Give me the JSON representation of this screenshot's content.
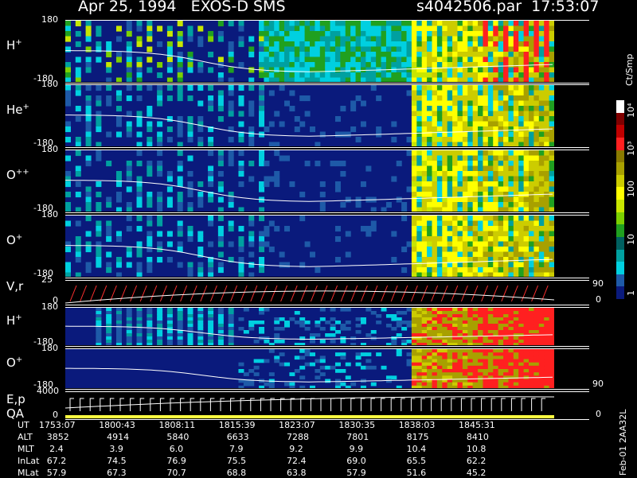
{
  "header": {
    "date_title": "Apr 25, 1994   EXOS-D SMS",
    "file_title": "s4042506.par  17:53:07"
  },
  "panels": [
    {
      "id": "h1",
      "label": "H",
      "sup": "+",
      "top": "180",
      "bottom": "-180"
    },
    {
      "id": "he",
      "label": "He",
      "sup": "+",
      "top": "180",
      "bottom": "-180"
    },
    {
      "id": "o2",
      "label": "O",
      "sup": "++",
      "top": "180",
      "bottom": "-180"
    },
    {
      "id": "o1",
      "label": "O",
      "sup": "+",
      "top": "180",
      "bottom": "-180"
    },
    {
      "id": "vr",
      "label": "V,r",
      "sup": "",
      "top": "25",
      "bottom": "0",
      "right_top": "90",
      "right_bottom": "0"
    },
    {
      "id": "h2",
      "label": "H",
      "sup": "+",
      "top": "180",
      "bottom": "-180"
    },
    {
      "id": "o3",
      "label": "O",
      "sup": "+",
      "top": "180",
      "bottom": "-180",
      "right_bottom": "90"
    },
    {
      "id": "ep",
      "label": "E,p",
      "label2": "QA",
      "top": "4000",
      "bottom": "0",
      "right_bottom": "0"
    }
  ],
  "colorbar": {
    "unit_label": "Ct/Smp",
    "tick_labels": [
      "10⁴",
      "10³",
      "100",
      "10",
      "1"
    ],
    "colors": [
      "#ffffff",
      "#800000",
      "#c00000",
      "#ff2020",
      "#8a7a00",
      "#a8a000",
      "#cccc00",
      "#ffff00",
      "#c8e600",
      "#7cd000",
      "#20a020",
      "#006060",
      "#00a0a0",
      "#00d0e0",
      "#1e5aa8",
      "#0a1a7c"
    ]
  },
  "table": {
    "row_labels": [
      "UT",
      "ALT",
      "MLT",
      "InLat",
      "MLat"
    ],
    "columns": [
      [
        "1753:07",
        "3852",
        "2.4",
        "67.2",
        "57.9"
      ],
      [
        "1800:43",
        "4914",
        "3.9",
        "74.5",
        "67.3"
      ],
      [
        "1808:11",
        "5840",
        "6.0",
        "76.9",
        "70.7"
      ],
      [
        "1815:39",
        "6633",
        "7.9",
        "75.5",
        "68.8"
      ],
      [
        "1823:07",
        "7288",
        "9.2",
        "72.4",
        "63.8"
      ],
      [
        "1830:35",
        "7801",
        "9.9",
        "69.0",
        "57.9"
      ],
      [
        "1838:03",
        "8175",
        "10.4",
        "65.5",
        "51.6"
      ],
      [
        "1845:31",
        "8410",
        "10.8",
        "62.2",
        "45.2"
      ]
    ]
  },
  "side_note": "Feb-01 2AA32L",
  "chart_data": {
    "type": "heatmap",
    "title": "Apr 25, 1994   EXOS-D SMS",
    "x_label": "UT",
    "x_ticks": [
      "1753:07",
      "1800:43",
      "1808:11",
      "1815:39",
      "1823:07",
      "1830:35",
      "1838:03",
      "1845:31"
    ],
    "x_range": [
      "1753:07",
      "1849:30"
    ],
    "y_range_pitch_panels": [
      -180,
      180
    ],
    "color_scale": "log",
    "color_range": [
      1,
      10000
    ],
    "panels": [
      "H+",
      "He+",
      "O++",
      "O+",
      "V,r",
      "H+",
      "O+",
      "E,p QA"
    ]
  }
}
